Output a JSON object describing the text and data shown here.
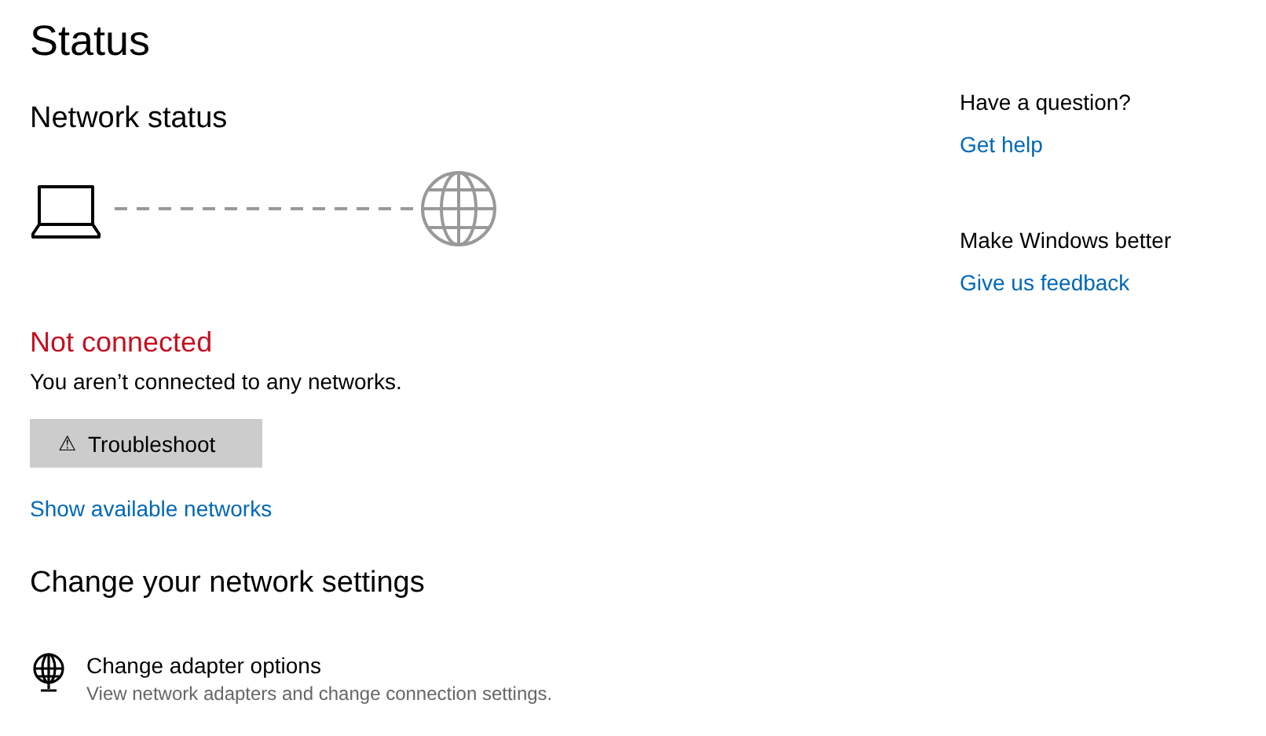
{
  "page": {
    "title": "Status"
  },
  "network_status": {
    "heading": "Network status",
    "connected": false,
    "status": "Not connected",
    "message": "You aren’t connected to any networks.",
    "troubleshoot_button": {
      "icon": "⚠",
      "label": "Troubleshoot"
    },
    "link": "Show available networks"
  },
  "change_settings": {
    "heading": "Change your network settings",
    "items": [
      {
        "title": "Change adapter options",
        "description": "View network adapters and change connection settings."
      }
    ]
  },
  "sidebar": [
    {
      "question": "Have a question?",
      "link": "Get help"
    },
    {
      "question": "Make Windows better",
      "link": "Give us feedback"
    }
  ]
}
